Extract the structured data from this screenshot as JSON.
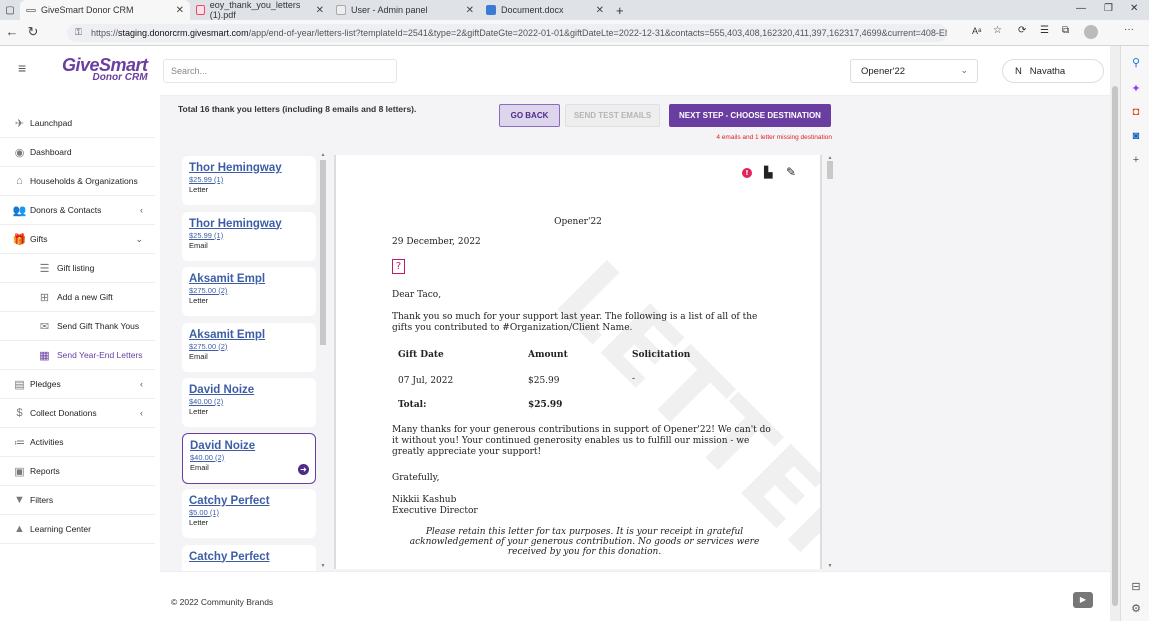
{
  "browser": {
    "tabs": [
      {
        "title": "GiveSmart Donor CRM"
      },
      {
        "title": "eoy_thank_you_letters (1).pdf"
      },
      {
        "title": "User - Admin panel"
      },
      {
        "title": "Document.docx"
      }
    ],
    "url_prefix": "https://",
    "url_host": "staging.donorcrm.givesmart.com",
    "url_path": "/app/end-of-year/letters-list?templateId=2541&type=2&giftDateGte=2022-01-01&giftDateLte=2022-12-31&contacts=555,403,408,162320,411,397,162317,4699&current=408-EMAIL"
  },
  "app": {
    "logo_main": "GiveSmart",
    "logo_sub": "Donor CRM",
    "search_placeholder": "Search...",
    "org_select": "Opener'22",
    "user_initial": "N",
    "user_name": "Navatha"
  },
  "sidebar": [
    {
      "label": "Launchpad",
      "icon": "rocket-icon"
    },
    {
      "label": "Dashboard",
      "icon": "dashboard-icon"
    },
    {
      "label": "Households & Organizations",
      "icon": "house-icon"
    },
    {
      "label": "Donors & Contacts",
      "icon": "people-icon",
      "chev": "‹"
    },
    {
      "label": "Gifts",
      "icon": "gift-icon",
      "chev": "⌄"
    },
    {
      "label": "Gift listing",
      "icon": "list-icon",
      "sub": true
    },
    {
      "label": "Add a new Gift",
      "icon": "plus-square-icon",
      "sub": true
    },
    {
      "label": "Send Gift Thank Yous",
      "icon": "envelope-icon",
      "sub": true
    },
    {
      "label": "Send Year-End Letters",
      "icon": "calendar-icon",
      "sub": true,
      "active": true
    },
    {
      "label": "Pledges",
      "icon": "pledge-icon",
      "chev": "‹"
    },
    {
      "label": "Collect Donations",
      "icon": "donate-icon",
      "chev": "‹"
    },
    {
      "label": "Activities",
      "icon": "activities-icon"
    },
    {
      "label": "Reports",
      "icon": "report-icon"
    },
    {
      "label": "Filters",
      "icon": "filter-icon"
    },
    {
      "label": "Learning Center",
      "icon": "graduation-cap-icon"
    }
  ],
  "main": {
    "summary": "Total 16 thank you letters (including 8 emails and 8 letters).",
    "go_back": "GO BACK",
    "send_test": "SEND TEST EMAILS",
    "next_step": "NEXT STEP - CHOOSE DESTINATION",
    "missing_note": "4 emails and 1 letter missing destination"
  },
  "recipients": [
    {
      "name": "Thor Hemingway",
      "amount": "$25.99 (1)",
      "type": "Letter"
    },
    {
      "name": "Thor Hemingway",
      "amount": "$25.99 (1)",
      "type": "Email"
    },
    {
      "name": "Aksamit Empl",
      "amount": "$275.00 (2)",
      "type": "Letter"
    },
    {
      "name": "Aksamit Empl",
      "amount": "$275.00 (2)",
      "type": "Email"
    },
    {
      "name": "David Noize",
      "amount": "$40.00 (2)",
      "type": "Letter"
    },
    {
      "name": "David Noize",
      "amount": "$40.00 (2)",
      "type": "Email",
      "selected": true
    },
    {
      "name": "Catchy Perfect",
      "amount": "$5.00 (1)",
      "type": "Letter"
    },
    {
      "name": "Catchy Perfect",
      "amount": "",
      "type": ""
    }
  ],
  "letter": {
    "org": "Opener'22",
    "date": "29 December, 2022",
    "greeting": "Dear Taco,",
    "intro": "Thank you so much for your support last year. The following is a list of all of the gifts you contributed to #Organization/Client Name.",
    "col_date": "Gift Date",
    "col_amount": "Amount",
    "col_solicitation": "Solicitation",
    "row_date": "07 Jul, 2022",
    "row_amount": "$25.99",
    "row_solicitation": "-",
    "total_label": "Total:",
    "total_amount": "$25.99",
    "body": "Many thanks for your generous contributions in support of Opener'22! We can't do it without you! Your continued generosity enables us to fulfill our mission - we greatly appreciate your support!",
    "closing": "Gratefully,",
    "signer": "Nikkii Kashub",
    "signer_title": "Executive Director",
    "tax_note": "Please retain this letter for tax purposes. It is your receipt in grateful acknowledgement of your generous contribution. No goods or services were received by you for this donation.",
    "watermark": "LETTER"
  },
  "footer": {
    "copyright": "© 2022 Community Brands"
  }
}
